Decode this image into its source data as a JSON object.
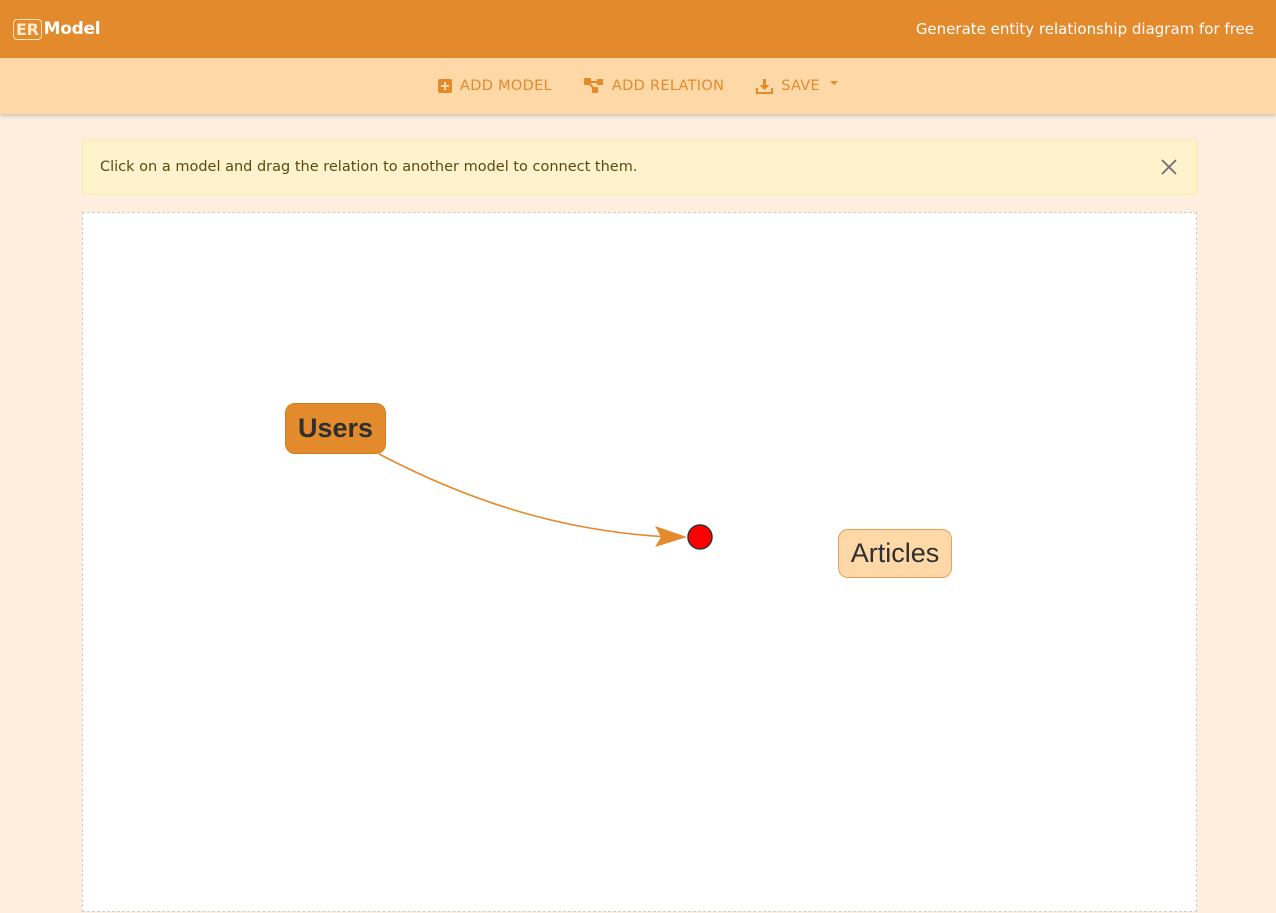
{
  "header": {
    "logo_box": "ER",
    "logo_text": "Model",
    "tagline": "Generate entity relationship diagram for free"
  },
  "toolbar": {
    "add_model": "ADD MODEL",
    "add_relation": "ADD RELATION",
    "save": "SAVE"
  },
  "alert": {
    "message": "Click on a model and drag the relation to another model to connect them."
  },
  "diagram": {
    "models": [
      {
        "name": "Users",
        "selected": true
      },
      {
        "name": "Articles",
        "selected": false
      }
    ],
    "colors": {
      "primary": "#e38b2c",
      "light": "#fed8a7",
      "handle": "#ff0000"
    }
  }
}
